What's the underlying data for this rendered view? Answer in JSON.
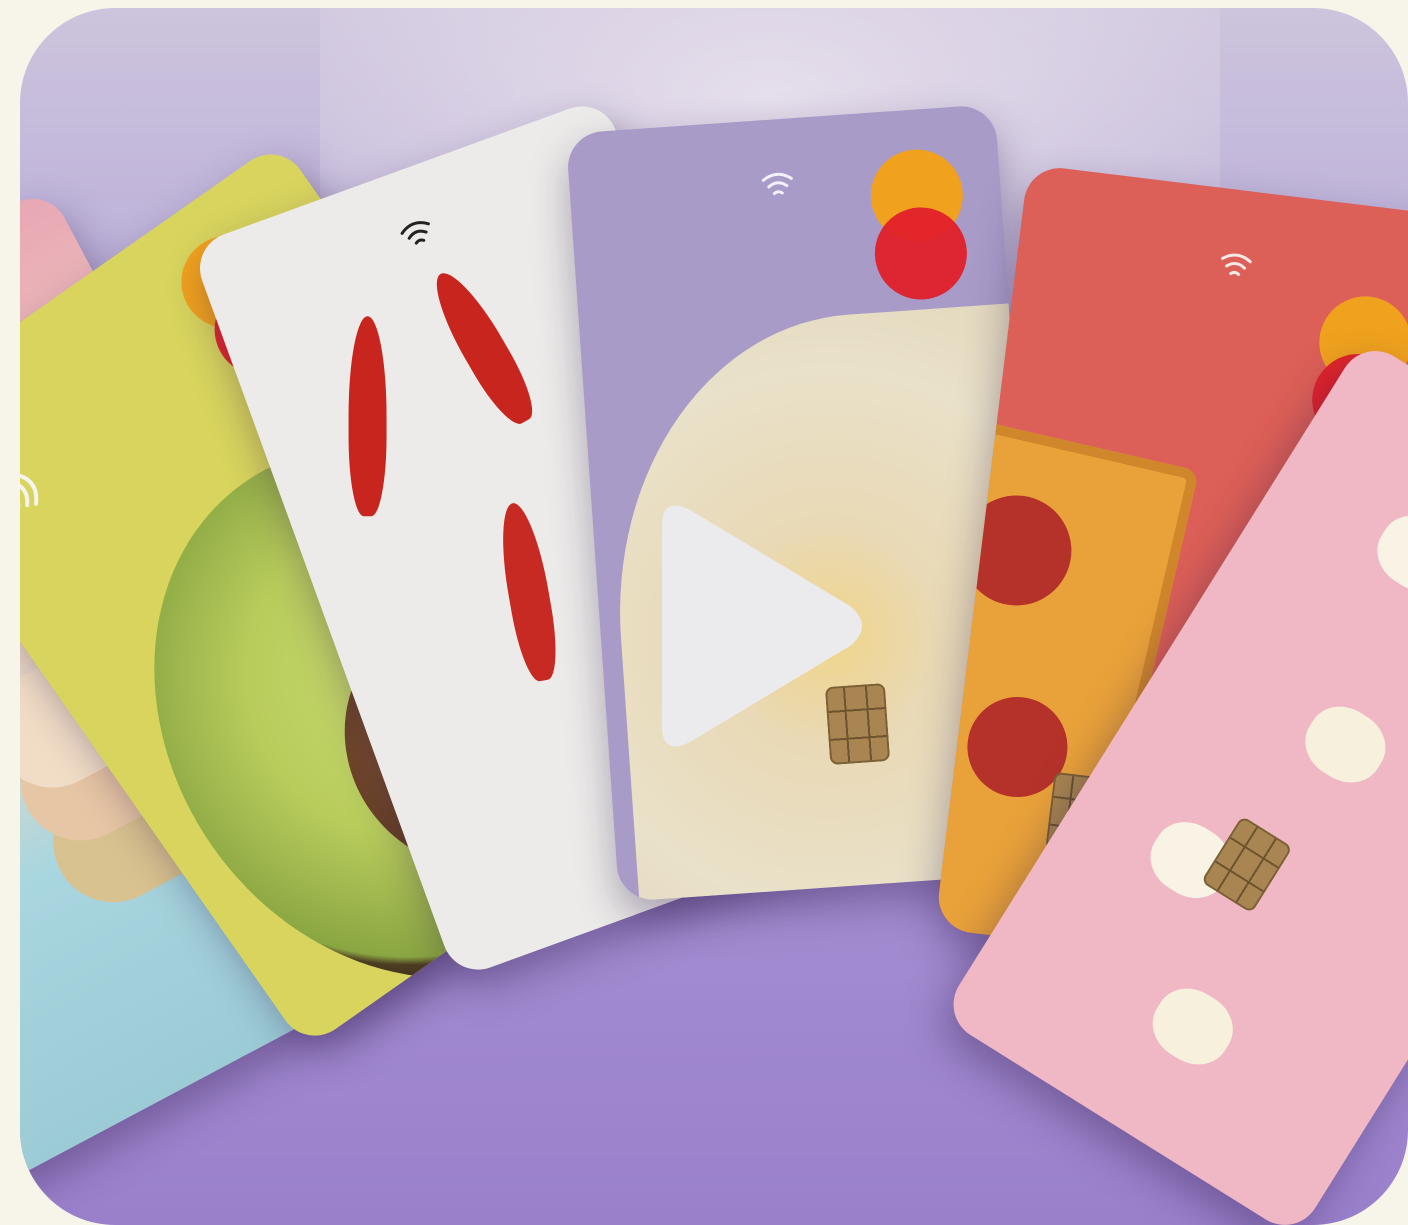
{
  "video": {
    "play_label": "",
    "accent": "#9a80cb"
  },
  "cards": [
    {
      "name": "macaron-card",
      "theme": "macarons",
      "bg": "#a8d4dc"
    },
    {
      "name": "avocado-card",
      "theme": "avocado",
      "bg": "#d9d65f"
    },
    {
      "name": "chili-card",
      "theme": "chili peppers",
      "bg": "#ecebea"
    },
    {
      "name": "hummus-card",
      "theme": "hummus",
      "bg": "#a99bc8"
    },
    {
      "name": "pizza-card",
      "theme": "pepperoni pizza",
      "bg": "#dc5f58"
    },
    {
      "name": "popcorn-card",
      "theme": "popcorn",
      "bg": "#f0b8c4"
    }
  ],
  "icons": {
    "brand": "mastercard-logo-icon",
    "contactless": "contactless-icon",
    "chip": "chip-icon",
    "play": "play-icon"
  }
}
